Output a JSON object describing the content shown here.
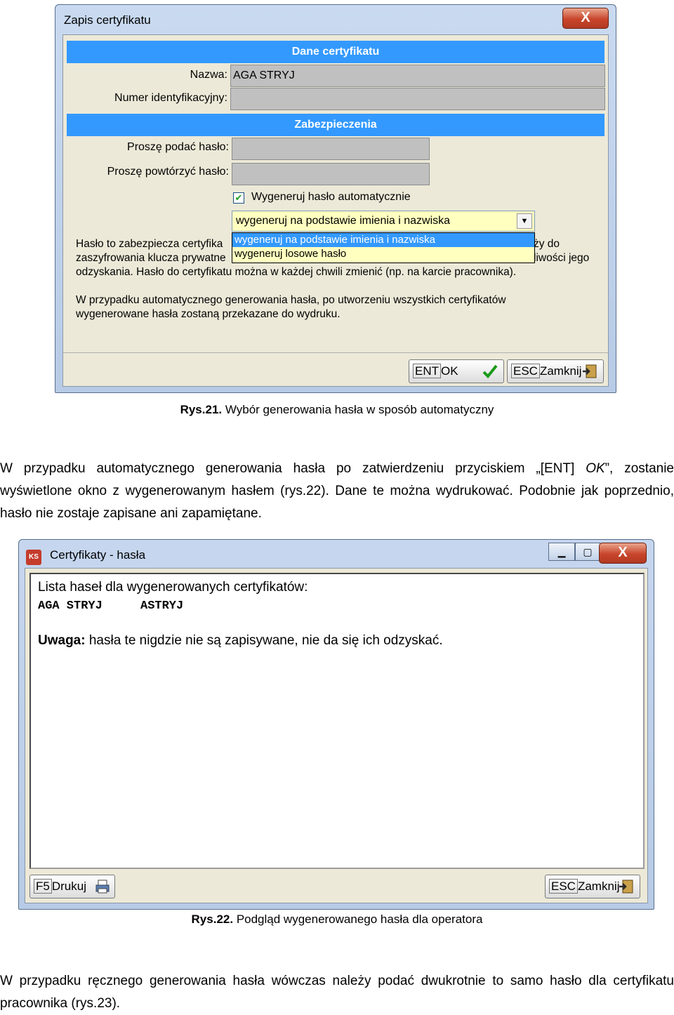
{
  "window1": {
    "title": "Zapis certyfikatu",
    "close": "X",
    "section_cert": "Dane certyfikatu",
    "name_label": "Nazwa:",
    "name_value": "AGA STRYJ",
    "id_label": "Numer identyfikacyjny:",
    "id_value": "",
    "section_security": "Zabezpieczenia",
    "password_label": "Proszę podać hasło:",
    "password_repeat_label": "Proszę powtórzyć hasło:",
    "auto_checkbox_label": "Wygeneruj hasło automatycznie",
    "auto_checked": true,
    "combo_value": "wygeneruj na podstawie imienia i nazwiska",
    "combo_options": [
      "wygeneruj na podstawie imienia i nazwiska",
      "wygeneruj losowe hasło"
    ],
    "info1_line1_left": "Hasło to zabezpiecza certyfika",
    "info1_line1_right": "ży do",
    "info1_line2_left": "zaszyfrowania klucza prywatne",
    "info1_line2_right": "liwości jego",
    "info1_line3": "odzyskania. Hasło do certyfikatu można w każdej chwili zmienić (np. na karcie pracownika).",
    "info2_line1": "W przypadku automatycznego generowania hasła, po utworzeniu wszystkich certyfikatów",
    "info2_line2": "wygenerowane hasła zostaną przekazane do wydruku.",
    "ok_key": "ENT",
    "ok_label": "OK",
    "close_key": "ESC",
    "close_label": "Zamknij"
  },
  "caption1": {
    "num": "Rys.21.",
    "text": "Wybór generowania hasła w sposób automatyczny"
  },
  "paragraph1": {
    "part1": "W przypadku automatycznego generowania hasła po zatwierdzeniu przyciskiem „[ENT] ",
    "italic": "OK",
    "part2": "”, zostanie wyświetlone okno z wygenerowanym hasłem (rys.22). Dane te można wydrukować. Podobnie jak poprzednio, hasło nie zostaje zapisane ani zapamiętane."
  },
  "window2": {
    "title": "Certyfikaty - hasła",
    "app_icon": "KS",
    "minimize": "▁",
    "maximize": "▢",
    "close": "X",
    "list_header": "Lista haseł dla wygenerowanych certyfikatów:",
    "cert_name": "AGA STRYJ",
    "cert_password": "ASTRYJ",
    "warning_label": "Uwaga:",
    "warning_text": " hasła te nigdzie nie są zapisywane, nie da się ich odzyskać.",
    "print_key": "F5",
    "print_label": "Drukuj",
    "close_key": "ESC",
    "close_label": "Zamknij"
  },
  "caption2": {
    "num": "Rys.22.",
    "text": "Podgląd wygenerowanego hasła dla operatora"
  },
  "paragraph2": {
    "text": "W przypadku ręcznego generowania hasła wówczas należy podać dwukrotnie to samo hasło dla certyfikatu pracownika (rys.23)."
  }
}
